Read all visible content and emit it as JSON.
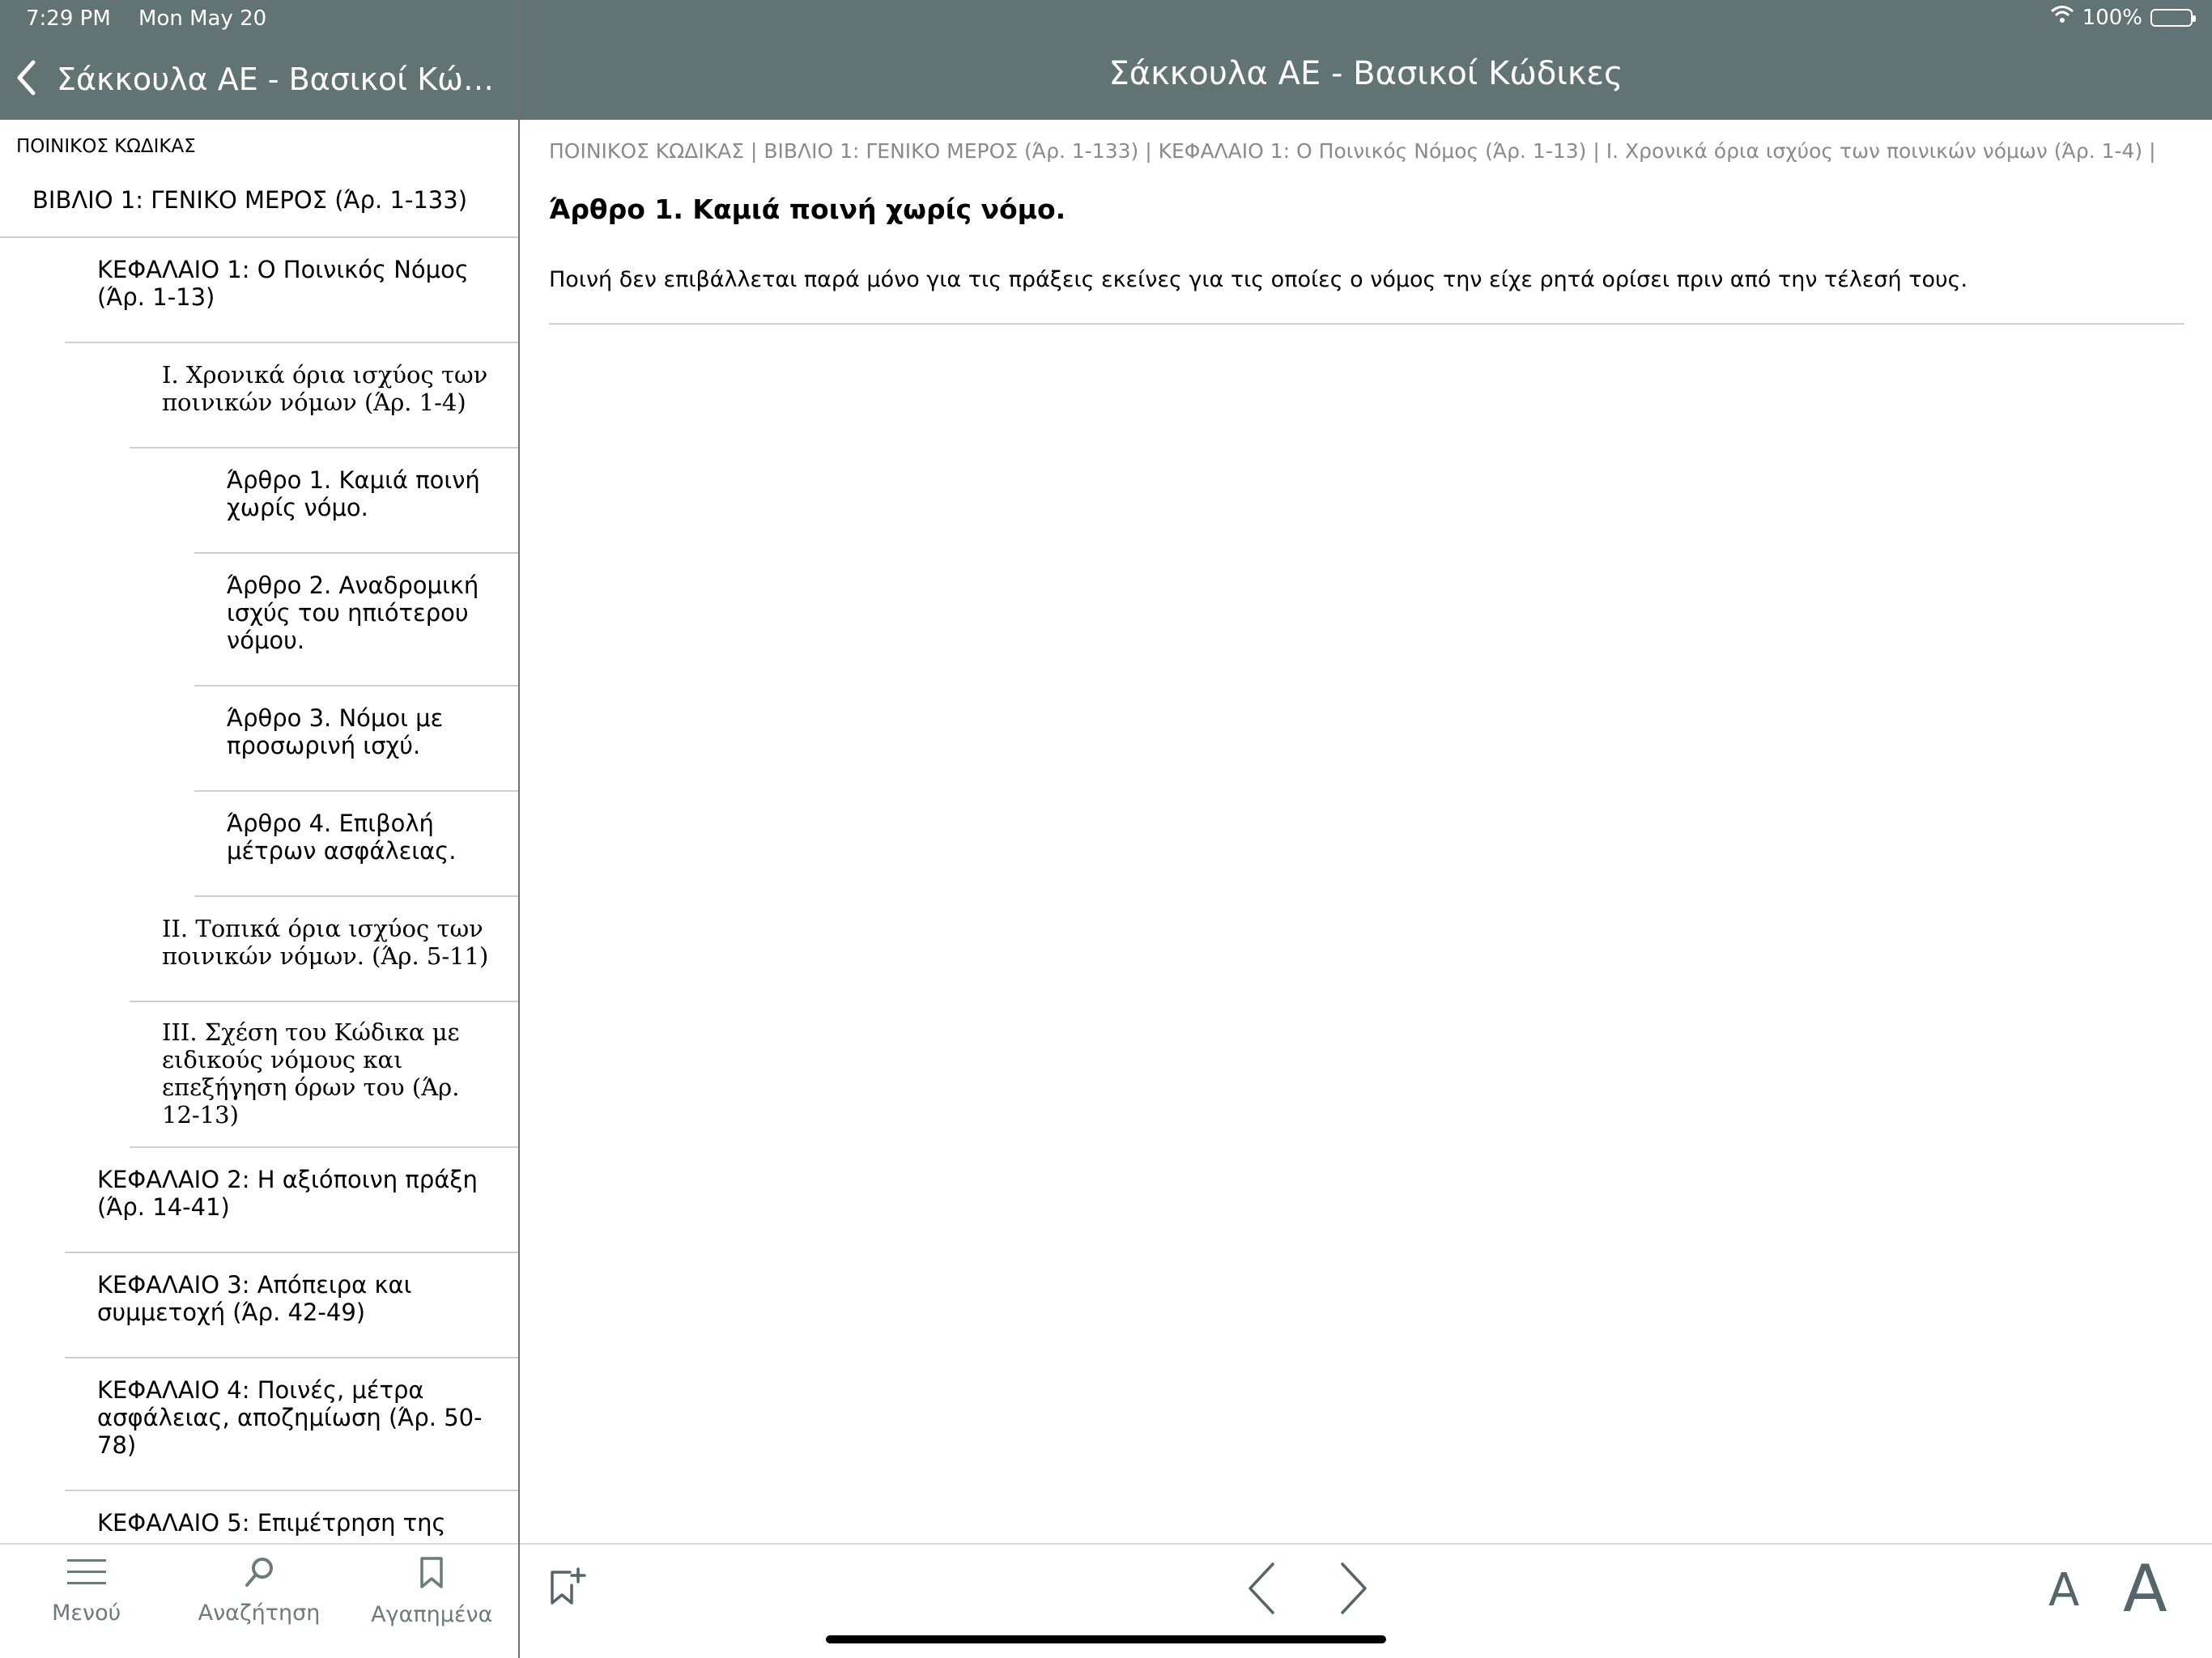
{
  "status": {
    "time": "7:29 PM",
    "date": "Mon May 20",
    "battery": "100%"
  },
  "nav": {
    "left_title": "Σάκκουλα ΑΕ - Βασικοί Κώδικες",
    "center_title": "Σάκκουλα ΑΕ - Βασικοί Κώδικες"
  },
  "sidebar": {
    "header": "ΠΟΙΝΙΚΟΣ ΚΩΔΙΚΑΣ",
    "items": [
      {
        "label": "ΒΙΒΛΙΟ 1: ΓΕΝΙΚΟ ΜΕΡΟΣ (Άρ. 1-133)",
        "level": 0
      },
      {
        "label": "ΚΕΦΑΛΑΙΟ 1: Ο Ποινικός Νόμος (Άρ. 1-13)",
        "level": 1
      },
      {
        "label": "Ι. Χρονικά όρια ισχύος των ποινικών νόμων (Άρ. 1-4)",
        "level": 2
      },
      {
        "label": "Άρθρο 1. Καμιά ποινή χωρίς νόμο.",
        "level": 3
      },
      {
        "label": "Άρθρο 2. Αναδρομική ισχύς του ηπιότερου νόμου.",
        "level": 3
      },
      {
        "label": "Άρθρο 3. Νόμοι με προσωρινή ισχύ.",
        "level": 3
      },
      {
        "label": "Άρθρο 4. Επιβολή μέτρων ασφάλειας.",
        "level": 3
      },
      {
        "label": "ΙΙ. Τοπικά όρια ισχύος των ποινικών νόμων. (Άρ. 5-11)",
        "level": 2
      },
      {
        "label": "ΙΙΙ. Σχέση του Κώδικα με ειδικούς νόμους και επεξήγηση όρων του (Άρ. 12-13)",
        "level": 2
      },
      {
        "label": "ΚΕΦΑΛΑΙΟ 2: Η αξιόποινη πράξη (Άρ. 14-41)",
        "level": 1
      },
      {
        "label": "ΚΕΦΑΛΑΙΟ 3: Απόπειρα και συμμετοχή (Άρ. 42-49)",
        "level": 1
      },
      {
        "label": "ΚΕΦΑΛΑΙΟ 4: Ποινές, μέτρα ασφάλειας, αποζημίωση (Άρ. 50-78)",
        "level": 1
      },
      {
        "label": "ΚΕΦΑΛΑΙΟ 5: Επιμέτρηση της",
        "level": 1
      }
    ]
  },
  "main": {
    "breadcrumb": "ΠΟΙΝΙΚΟΣ ΚΩΔΙΚΑΣ | ΒΙΒΛΙΟ 1: ΓΕΝΙΚΟ ΜΕΡΟΣ (Άρ. 1-133) | ΚΕΦΑΛΑΙΟ 1: Ο Ποινικός Νόμος (Άρ. 1-13) | Ι. Χρονικά όρια ισχύος των ποινικών νόμων (Άρ. 1-4) |",
    "article_title": "Άρθρο 1. Καμιά ποινή χωρίς νόμο.",
    "article_body": "Ποινή δεν επιβάλλεται παρά μόνο για τις πράξεις εκείνες για τις οποίες ο νόμος την είχε ρητά ορίσει πριν από την τέλεσή τους."
  },
  "tabs": {
    "menu": "Μενού",
    "search": "Αναζήτηση",
    "favorites": "Αγαπημένα"
  },
  "toolbar": {
    "font_small": "A",
    "font_large": "A"
  },
  "icons": [
    "back-chevron-icon",
    "wifi-icon",
    "battery-icon",
    "menu-icon",
    "search-icon",
    "bookmark-icon",
    "bookmark-add-icon",
    "chevron-left-icon",
    "chevron-right-icon"
  ],
  "colors": {
    "bar": "#627373",
    "tab_text": "#6b7b7b",
    "breadcrumb": "#8a8a8a"
  }
}
